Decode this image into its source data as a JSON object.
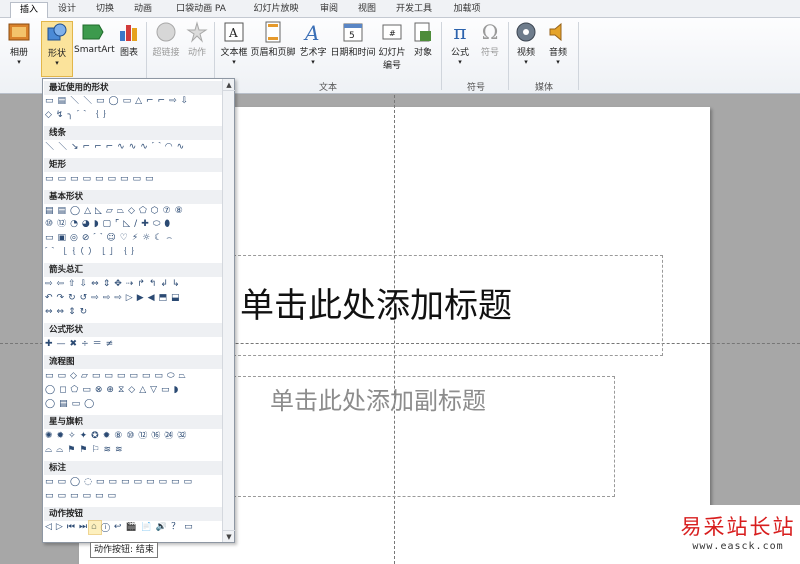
{
  "tabs": [
    "插入",
    "设计",
    "切换",
    "动画",
    "口袋动画 PA",
    "幻灯片放映",
    "审阅",
    "视图",
    "开发工具",
    "加载项"
  ],
  "ribbon": {
    "album": "相册",
    "shapes": "形状",
    "smartart": "SmartArt",
    "chart": "图表",
    "hyperlink": "超链接",
    "action": "动作",
    "textbox": "文本框",
    "header_footer": "页眉和页脚",
    "wordart": "艺术字",
    "datetime": "日期和时间",
    "slide_number_1": "幻灯片",
    "slide_number_2": "编号",
    "object": "对象",
    "equation": "公式",
    "symbol": "符号",
    "video": "视频",
    "audio": "音频",
    "group_text": "文本",
    "group_symbols": "符号",
    "group_media": "媒体"
  },
  "gallery": {
    "categories": [
      "最近使用的形状",
      "线条",
      "矩形",
      "基本形状",
      "箭头总汇",
      "公式形状",
      "流程图",
      "星与旗帜",
      "标注",
      "动作按钮"
    ],
    "rows": {
      "recent_1": "▭▤＼＼▭◯▭△⌐⌐⇨⇩",
      "recent_2": "◇↯╮⌒｛｝",
      "lines_1": "＼＼↘⌐⌐⌐∿∿∿⌒◠∿",
      "rect_1": "▭▭▭▭▭▭▭▭▭",
      "basic_1": "▤▤◯△◺▱⏢◇⬠⬡⑦⑧",
      "basic_2": "⑩⑫◔◕◗▢⌜◺∕✚⬭⬮",
      "basic_3": "▭▣◎⊘⌒☺♡⚡☼☾⌢",
      "basic_4": "⌒［｛（）［］｛｝",
      "arrow_1": "⇨⇦⇧⇩⇔⇕✥⇢↱↰↲↳",
      "arrow_2": "↶↷↻↺⇨⇨⇨▷▶◀⬒⬓",
      "arrow_3": "⇔⇔⇕↻",
      "math_1": "✚—✖÷＝≠",
      "flow_1": "▭▭◇▱▭▭▭▭▭▭⬭⏢",
      "flow_2": "◯◻⬠▭⊗⊕⧖◇△▽▭◗",
      "flow_3": "◯▤▭◯",
      "star_1": "✺✹✧✦✪✹⑧⑩⑫⑯㉔㉜",
      "star_2": "⌓⌓⚑⚑⚐≋≋",
      "callout_1": "▭▭◯◌▭▭▭▭▭▭▭▭",
      "callout_2": "▭▭▭▭▭▭",
      "action_1": "◁▷⏮⏭⌂ⓘ↩🎬📄🔊？▭"
    },
    "selected_label": "动作按钮: 结束"
  },
  "slide": {
    "title_placeholder": "单击此处添加标题",
    "subtitle_placeholder": "单击此处添加副标题"
  },
  "watermark": {
    "name": "易采站长站",
    "url": "www.easck.com"
  }
}
